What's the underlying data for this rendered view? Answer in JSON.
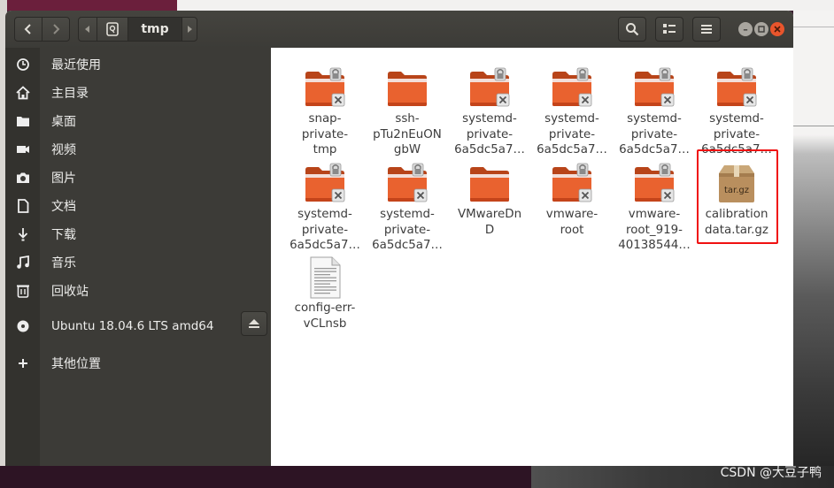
{
  "header": {
    "path_current": "tmp"
  },
  "sidebar": {
    "items": [
      {
        "label": "最近使用",
        "icon": "clock-icon"
      },
      {
        "label": "主目录",
        "icon": "home-icon"
      },
      {
        "label": "桌面",
        "icon": "folder-icon"
      },
      {
        "label": "视频",
        "icon": "video-icon"
      },
      {
        "label": "图片",
        "icon": "camera-icon"
      },
      {
        "label": "文档",
        "icon": "document-icon"
      },
      {
        "label": "下载",
        "icon": "download-icon"
      },
      {
        "label": "音乐",
        "icon": "music-icon"
      },
      {
        "label": "回收站",
        "icon": "trash-icon"
      },
      {
        "label": "Ubuntu 18.04.6 LTS amd64",
        "icon": "disc-icon"
      },
      {
        "label": "其他位置",
        "icon": "plus-icon"
      }
    ]
  },
  "files": [
    {
      "name": "snap-\nprivate-\ntmp",
      "type": "locked-folder"
    },
    {
      "name": "ssh-\npTu2nEuON\ngbW",
      "type": "folder"
    },
    {
      "name": "systemd-\nprivate-\n6a5dc5a7…",
      "type": "locked-folder"
    },
    {
      "name": "systemd-\nprivate-\n6a5dc5a7…",
      "type": "locked-folder"
    },
    {
      "name": "systemd-\nprivate-\n6a5dc5a7…",
      "type": "locked-folder"
    },
    {
      "name": "systemd-\nprivate-\n6a5dc5a7…",
      "type": "locked-folder"
    },
    {
      "name": "systemd-\nprivate-\n6a5dc5a7…",
      "type": "locked-folder"
    },
    {
      "name": "systemd-\nprivate-\n6a5dc5a7…",
      "type": "locked-folder"
    },
    {
      "name": "VMwareDn\nD",
      "type": "folder"
    },
    {
      "name": "vmware-\nroot",
      "type": "locked-folder"
    },
    {
      "name": "vmware-\nroot_919-\n40138544…",
      "type": "locked-folder"
    },
    {
      "name": "calibration\ndata.tar.gz",
      "type": "archive",
      "archive_label": "tar.gz"
    },
    {
      "name": "config-err-\nvCLnsb",
      "type": "text-file"
    }
  ],
  "watermark": "CSDN @大豆子鸭",
  "colors": {
    "folder_orange": "#e9622f",
    "headerbar": "#3c3b37",
    "close_button": "#e9552c",
    "highlight_box": "#f01010"
  }
}
